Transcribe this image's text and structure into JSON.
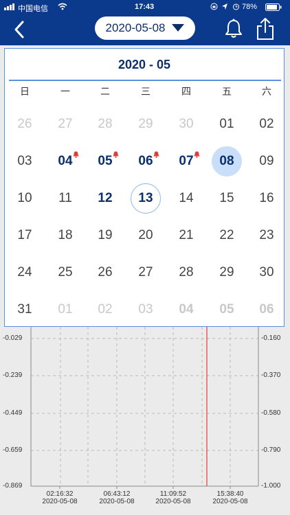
{
  "status": {
    "carrier": "中国电信",
    "time": "17:43",
    "battery": "78%"
  },
  "header": {
    "date": "2020-05-08"
  },
  "calendar": {
    "title": "2020 - 05",
    "weekdays": [
      "日",
      "一",
      "二",
      "三",
      "四",
      "五",
      "六"
    ],
    "days": [
      [
        "26",
        "27",
        "28",
        "29",
        "30",
        "01",
        "02"
      ],
      [
        "03",
        "04",
        "05",
        "06",
        "07",
        "08",
        "09"
      ],
      [
        "10",
        "11",
        "12",
        "13",
        "14",
        "15",
        "16"
      ],
      [
        "17",
        "18",
        "19",
        "20",
        "21",
        "22",
        "23"
      ],
      [
        "24",
        "25",
        "26",
        "27",
        "28",
        "29",
        "30"
      ],
      [
        "31",
        "01",
        "02",
        "03",
        "04",
        "05",
        "06"
      ]
    ]
  },
  "chart_data": {
    "type": "line",
    "left_axis_ticks": [
      "-0.029",
      "-0.239",
      "-0.449",
      "-0.659",
      "-0.869"
    ],
    "right_axis_ticks": [
      "-0.160",
      "-0.370",
      "-0.580",
      "-0.790",
      "-1.000"
    ],
    "x_ticks": [
      {
        "time": "02:16:32",
        "date": "2020-05-08"
      },
      {
        "time": "06:43:12",
        "date": "2020-05-08"
      },
      {
        "time": "11:09:52",
        "date": "2020-05-08"
      },
      {
        "time": "15:38:40",
        "date": "2020-05-08"
      }
    ],
    "cursor_color": "#e23b3b"
  }
}
